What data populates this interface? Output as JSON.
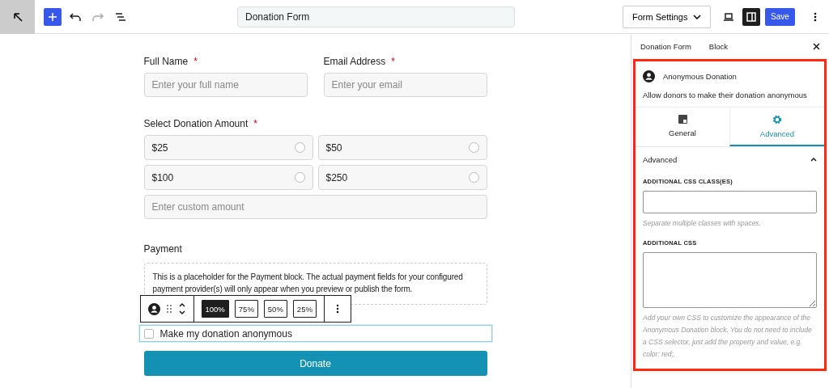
{
  "topbar": {
    "title": "Donation Form",
    "form_settings": "Form Settings",
    "save": "Save",
    "sidebar_open": true
  },
  "form": {
    "fields": [
      {
        "label": "Full Name",
        "required": "*",
        "placeholder": "Enter your full name"
      },
      {
        "label": "Email Address",
        "required": "*",
        "placeholder": "Enter your email"
      }
    ],
    "amount": {
      "label": "Select Donation Amount",
      "required": "*",
      "options": [
        {
          "label": "$25",
          "selected": false
        },
        {
          "label": "$50",
          "selected": false
        },
        {
          "label": "$100",
          "selected": false
        },
        {
          "label": "$250",
          "selected": false
        }
      ],
      "custom_placeholder": "Enter custom amount"
    },
    "payment": {
      "label": "Payment",
      "note": "This is a placeholder for the Payment block. The actual payment fields for your configured payment provider(s) will only appear when you preview or publish the form."
    },
    "anonymous": {
      "label": "Make my donation anonymous",
      "checked": false,
      "selected": true
    },
    "donate": "Donate"
  },
  "block_toolbar": {
    "widths": [
      {
        "label": "100%",
        "selected": true
      },
      {
        "label": "75%",
        "selected": false
      },
      {
        "label": "50%",
        "selected": false
      },
      {
        "label": "25%",
        "selected": false
      }
    ]
  },
  "sidebar": {
    "tabs": [
      {
        "label": "Donation Form"
      },
      {
        "label": "Block"
      }
    ],
    "block": {
      "title": "Anonymous Donation",
      "description": "Allow donors to make their donation anonymous"
    },
    "panel_tabs": [
      {
        "label": "General",
        "kind": "general",
        "selected": false
      },
      {
        "label": "Advanced",
        "kind": "advanced",
        "selected": true
      }
    ],
    "section": {
      "title": "Advanced",
      "expanded": true
    },
    "css_class": {
      "label": "ADDITIONAL CSS CLASS(ES)",
      "hint": "Separate multiple classes with spaces."
    },
    "css": {
      "label": "ADDITIONAL CSS",
      "help": "Add your own CSS to customize the appearance of the Anonymous Donation block. You do not need to include a CSS selector, just add the property and value, e.g. color: red;."
    }
  }
}
